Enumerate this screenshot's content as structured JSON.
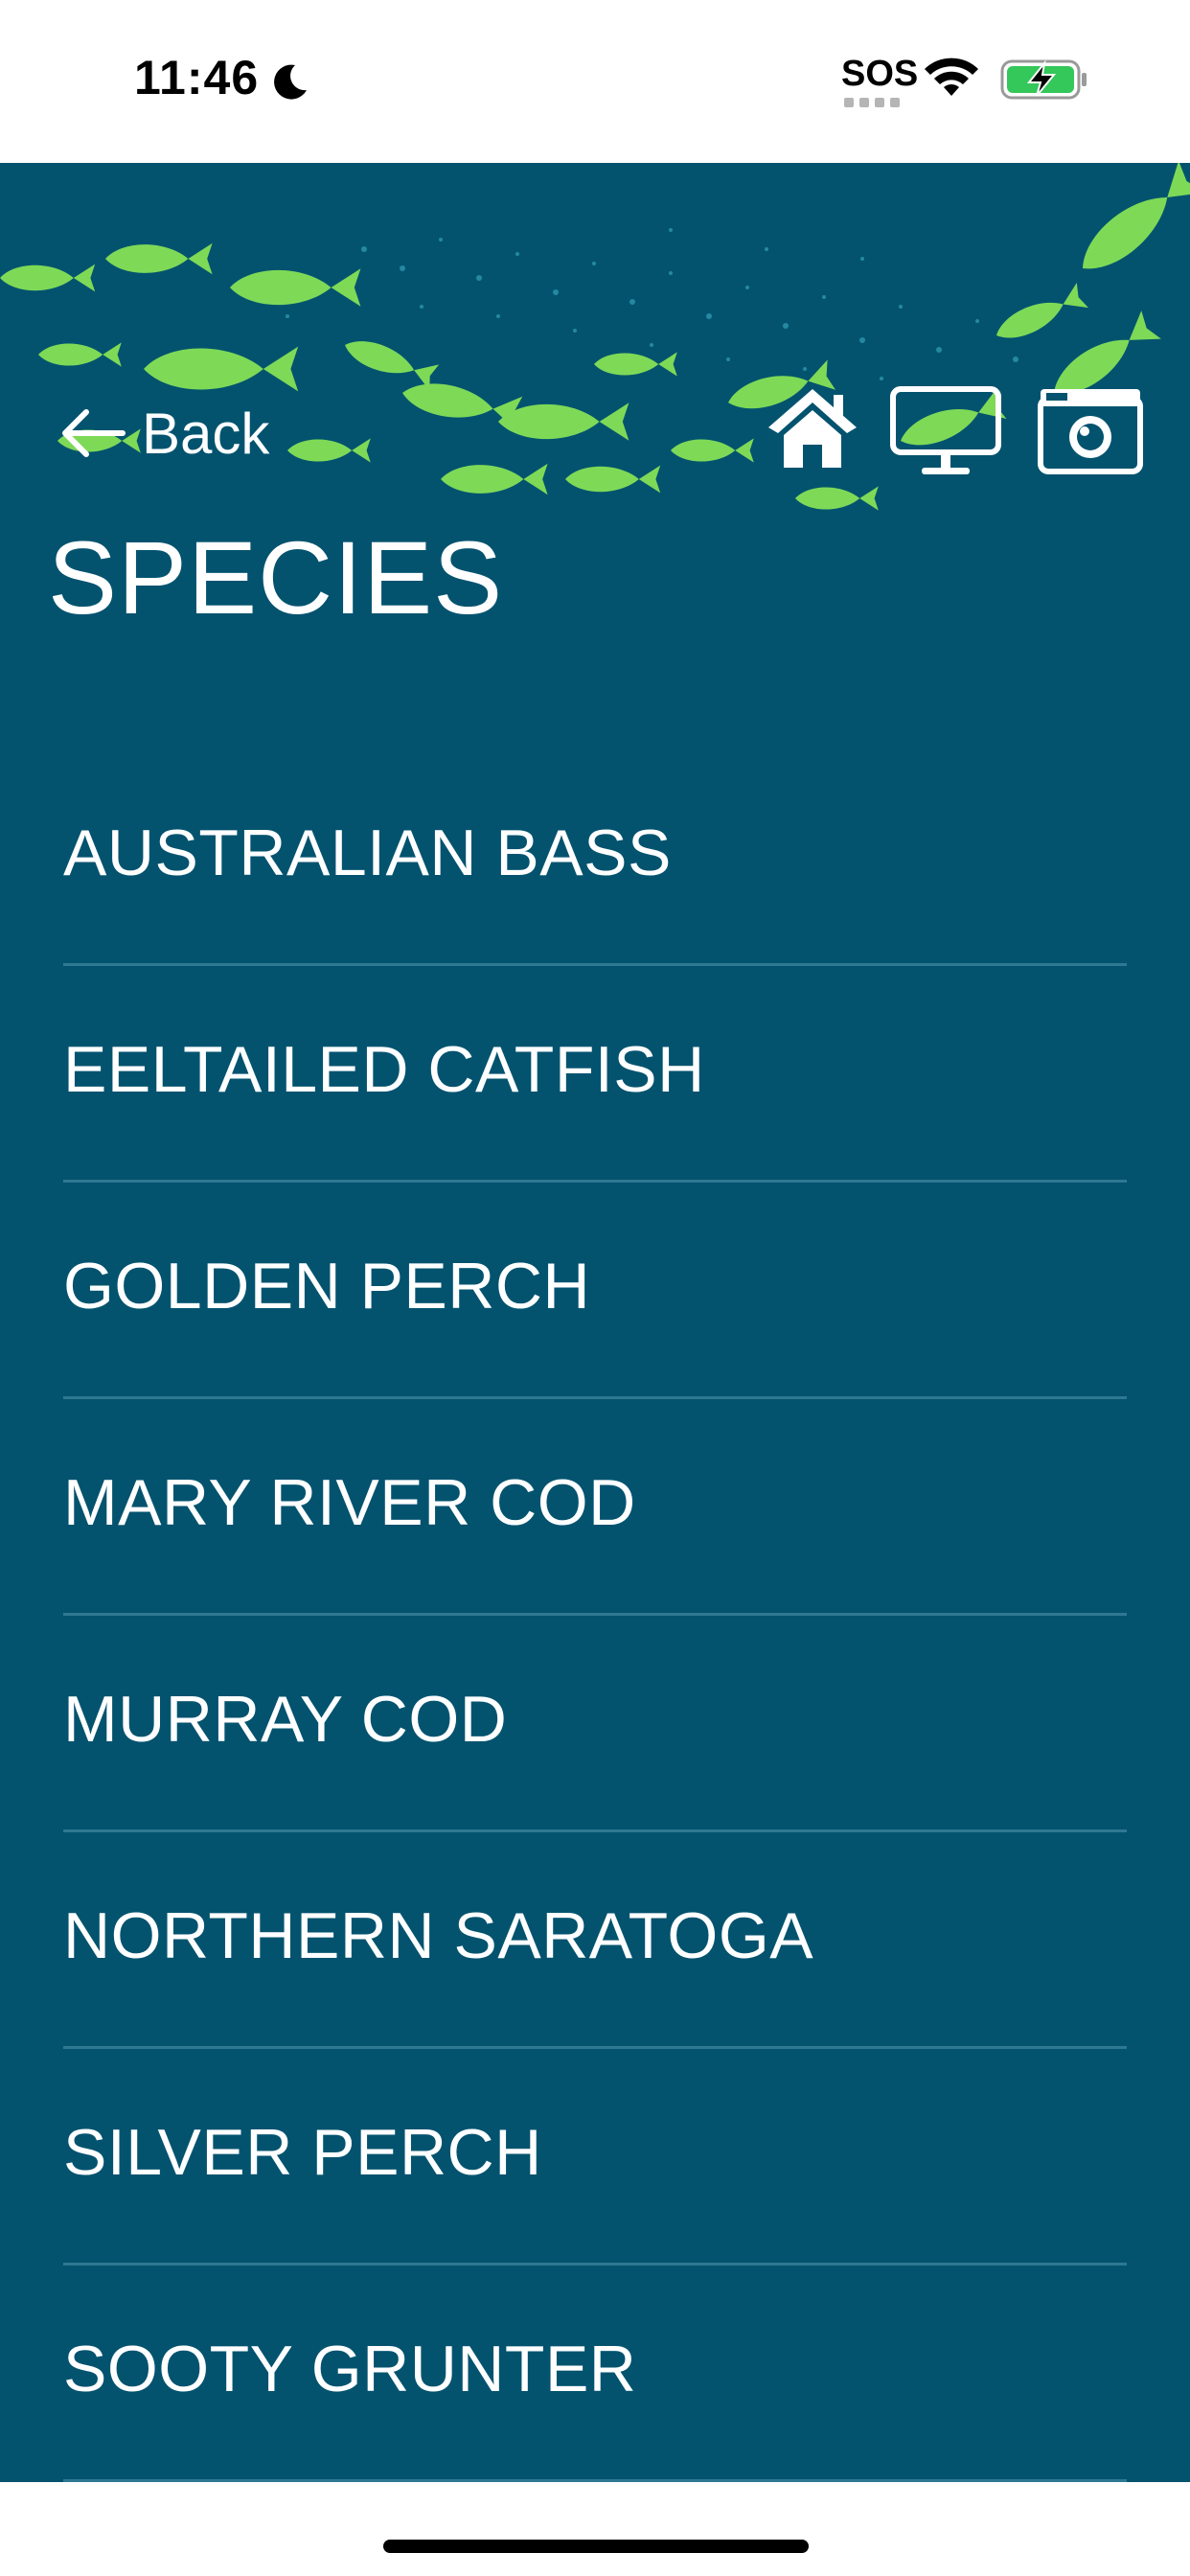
{
  "status_bar": {
    "time": "11:46",
    "sos": "SOS",
    "icons": [
      "moon-icon",
      "wifi-icon",
      "battery-charging-icon"
    ],
    "battery_color": "#34c759"
  },
  "header": {
    "back_label": "Back",
    "icons": [
      "arrow-left-icon",
      "home-icon",
      "monitor-icon",
      "camera-icon"
    ],
    "banner": "fish-school-illustration"
  },
  "page": {
    "title": "SPECIES"
  },
  "species": [
    "AUSTRALIAN BASS",
    "EELTAILED CATFISH",
    "GOLDEN PERCH",
    "MARY RIVER COD",
    "MURRAY COD",
    "NORTHERN SARATOGA",
    "SILVER PERCH",
    "SOOTY GRUNTER"
  ],
  "colors": {
    "background": "#03536f",
    "fish": "#7ed957",
    "text": "#ffffff",
    "divider": "#2f7891"
  }
}
